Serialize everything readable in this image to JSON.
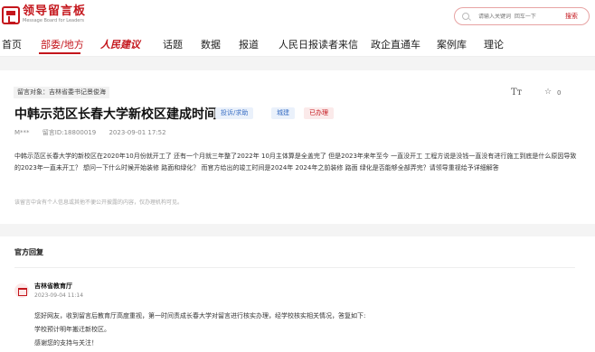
{
  "header": {
    "logo_title": "领导留言板",
    "logo_subtitle": "Message Board for Leaders",
    "search": {
      "placeholder": "请输入关键词  回车一下",
      "button": "搜索"
    }
  },
  "nav": {
    "items": [
      {
        "label": "首页"
      },
      {
        "label": "部委/地方"
      },
      {
        "label": "人民建议"
      },
      {
        "label": "话题"
      },
      {
        "label": "数据"
      },
      {
        "label": "报道"
      },
      {
        "label": "人民日报读者来信"
      },
      {
        "label": "政企直通车"
      },
      {
        "label": "案例库"
      },
      {
        "label": "理论"
      }
    ],
    "active": "部委/地方"
  },
  "message": {
    "target": "留言对象：吉林省委书记景俊海",
    "title": "中韩示范区长春大学新校区建成时间",
    "tags": {
      "type": "投诉/求助",
      "domain": "城建",
      "status": "已办理"
    },
    "favorite_count": "0",
    "author": "M***",
    "id": "留言ID:18800019",
    "time": "2023-09-01 17:52",
    "body": "中韩示范区长春大学的新校区在2020年10月份就开工了 还有一个月就三年整了2022年 10月主体算是全盖完了 但是2023年来年至今 一直没开工 工程方说是没钱一直没有进行施工到底是什么原因导致的2023年一直未开工？  想问一下什么时候开始装修 路面和绿化？ 而官方给出的竣工时间是2024年 2024年之前装修 路面 绿化是否能够全部弄完？请领导重视给予详细解答",
    "disclaimer": "该留言中含有个人信息或其他不便公开披露的内容，仅办理机构可见。"
  },
  "reply": {
    "heading": "官方回复",
    "department": "吉林省教育厅",
    "time": "2023-09-04 11:14",
    "lines": [
      "您好网友，收到留言后教育厅高度重视，第一时间责成长春大学对留言进行核实办理，经学校核实相关情况，答复如下:",
      "学校预计明年搬迁新校区。",
      "感谢您的支持与关注！"
    ]
  }
}
